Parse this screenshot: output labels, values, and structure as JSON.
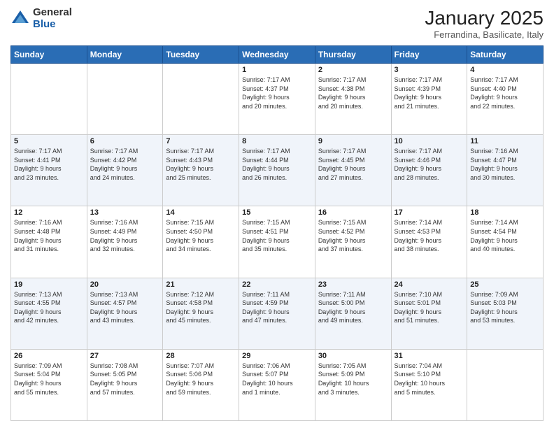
{
  "header": {
    "logo_general": "General",
    "logo_blue": "Blue",
    "month_title": "January 2025",
    "location": "Ferrandina, Basilicate, Italy"
  },
  "weekdays": [
    "Sunday",
    "Monday",
    "Tuesday",
    "Wednesday",
    "Thursday",
    "Friday",
    "Saturday"
  ],
  "weeks": [
    [
      {
        "day": "",
        "info": ""
      },
      {
        "day": "",
        "info": ""
      },
      {
        "day": "",
        "info": ""
      },
      {
        "day": "1",
        "info": "Sunrise: 7:17 AM\nSunset: 4:37 PM\nDaylight: 9 hours\nand 20 minutes."
      },
      {
        "day": "2",
        "info": "Sunrise: 7:17 AM\nSunset: 4:38 PM\nDaylight: 9 hours\nand 20 minutes."
      },
      {
        "day": "3",
        "info": "Sunrise: 7:17 AM\nSunset: 4:39 PM\nDaylight: 9 hours\nand 21 minutes."
      },
      {
        "day": "4",
        "info": "Sunrise: 7:17 AM\nSunset: 4:40 PM\nDaylight: 9 hours\nand 22 minutes."
      }
    ],
    [
      {
        "day": "5",
        "info": "Sunrise: 7:17 AM\nSunset: 4:41 PM\nDaylight: 9 hours\nand 23 minutes."
      },
      {
        "day": "6",
        "info": "Sunrise: 7:17 AM\nSunset: 4:42 PM\nDaylight: 9 hours\nand 24 minutes."
      },
      {
        "day": "7",
        "info": "Sunrise: 7:17 AM\nSunset: 4:43 PM\nDaylight: 9 hours\nand 25 minutes."
      },
      {
        "day": "8",
        "info": "Sunrise: 7:17 AM\nSunset: 4:44 PM\nDaylight: 9 hours\nand 26 minutes."
      },
      {
        "day": "9",
        "info": "Sunrise: 7:17 AM\nSunset: 4:45 PM\nDaylight: 9 hours\nand 27 minutes."
      },
      {
        "day": "10",
        "info": "Sunrise: 7:17 AM\nSunset: 4:46 PM\nDaylight: 9 hours\nand 28 minutes."
      },
      {
        "day": "11",
        "info": "Sunrise: 7:16 AM\nSunset: 4:47 PM\nDaylight: 9 hours\nand 30 minutes."
      }
    ],
    [
      {
        "day": "12",
        "info": "Sunrise: 7:16 AM\nSunset: 4:48 PM\nDaylight: 9 hours\nand 31 minutes."
      },
      {
        "day": "13",
        "info": "Sunrise: 7:16 AM\nSunset: 4:49 PM\nDaylight: 9 hours\nand 32 minutes."
      },
      {
        "day": "14",
        "info": "Sunrise: 7:15 AM\nSunset: 4:50 PM\nDaylight: 9 hours\nand 34 minutes."
      },
      {
        "day": "15",
        "info": "Sunrise: 7:15 AM\nSunset: 4:51 PM\nDaylight: 9 hours\nand 35 minutes."
      },
      {
        "day": "16",
        "info": "Sunrise: 7:15 AM\nSunset: 4:52 PM\nDaylight: 9 hours\nand 37 minutes."
      },
      {
        "day": "17",
        "info": "Sunrise: 7:14 AM\nSunset: 4:53 PM\nDaylight: 9 hours\nand 38 minutes."
      },
      {
        "day": "18",
        "info": "Sunrise: 7:14 AM\nSunset: 4:54 PM\nDaylight: 9 hours\nand 40 minutes."
      }
    ],
    [
      {
        "day": "19",
        "info": "Sunrise: 7:13 AM\nSunset: 4:55 PM\nDaylight: 9 hours\nand 42 minutes."
      },
      {
        "day": "20",
        "info": "Sunrise: 7:13 AM\nSunset: 4:57 PM\nDaylight: 9 hours\nand 43 minutes."
      },
      {
        "day": "21",
        "info": "Sunrise: 7:12 AM\nSunset: 4:58 PM\nDaylight: 9 hours\nand 45 minutes."
      },
      {
        "day": "22",
        "info": "Sunrise: 7:11 AM\nSunset: 4:59 PM\nDaylight: 9 hours\nand 47 minutes."
      },
      {
        "day": "23",
        "info": "Sunrise: 7:11 AM\nSunset: 5:00 PM\nDaylight: 9 hours\nand 49 minutes."
      },
      {
        "day": "24",
        "info": "Sunrise: 7:10 AM\nSunset: 5:01 PM\nDaylight: 9 hours\nand 51 minutes."
      },
      {
        "day": "25",
        "info": "Sunrise: 7:09 AM\nSunset: 5:03 PM\nDaylight: 9 hours\nand 53 minutes."
      }
    ],
    [
      {
        "day": "26",
        "info": "Sunrise: 7:09 AM\nSunset: 5:04 PM\nDaylight: 9 hours\nand 55 minutes."
      },
      {
        "day": "27",
        "info": "Sunrise: 7:08 AM\nSunset: 5:05 PM\nDaylight: 9 hours\nand 57 minutes."
      },
      {
        "day": "28",
        "info": "Sunrise: 7:07 AM\nSunset: 5:06 PM\nDaylight: 9 hours\nand 59 minutes."
      },
      {
        "day": "29",
        "info": "Sunrise: 7:06 AM\nSunset: 5:07 PM\nDaylight: 10 hours\nand 1 minute."
      },
      {
        "day": "30",
        "info": "Sunrise: 7:05 AM\nSunset: 5:09 PM\nDaylight: 10 hours\nand 3 minutes."
      },
      {
        "day": "31",
        "info": "Sunrise: 7:04 AM\nSunset: 5:10 PM\nDaylight: 10 hours\nand 5 minutes."
      },
      {
        "day": "",
        "info": ""
      }
    ]
  ]
}
